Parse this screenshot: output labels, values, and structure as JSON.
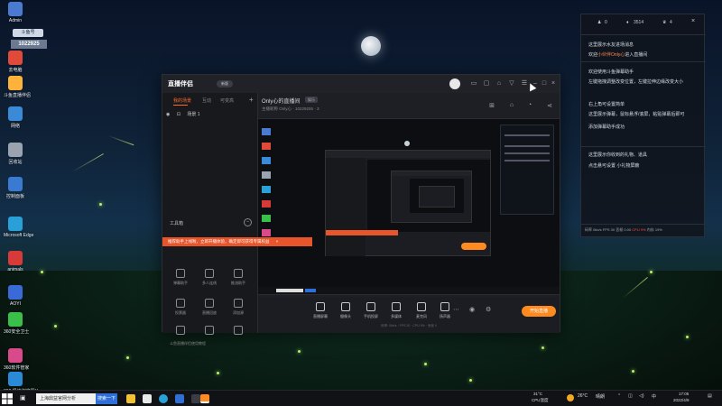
{
  "desktop": {
    "icons": [
      {
        "label": "Admin",
        "color": "#4a7bd0"
      },
      {
        "label": "去电脑",
        "color": "#e04a3a"
      },
      {
        "label": "斗鱼直播伴侣",
        "color": "#ffb23a"
      },
      {
        "label": "网络",
        "color": "#3a8ad8"
      },
      {
        "label": "回收站",
        "color": "#9aa4b0"
      },
      {
        "label": "控制面板",
        "color": "#3a7ad0"
      },
      {
        "label": "Microsoft Edge",
        "color": "#2aa0d8"
      },
      {
        "label": "animals",
        "color": "#d83a3a"
      },
      {
        "label": "AOYI",
        "color": "#3a6ad8"
      },
      {
        "label": "360安全卫士",
        "color": "#3ac04a"
      },
      {
        "label": "360软件管家",
        "color": "#d84a8a"
      },
      {
        "label": "360 极速浏览器X",
        "color": "#2a8ad8"
      }
    ],
    "overlay_badge": "1022925",
    "overlay_tag": "斗鱼号"
  },
  "app": {
    "logo": "直播伴侣",
    "version": "新版",
    "left_tabs": [
      "我的场景",
      "互动",
      "可变高"
    ],
    "scene_name": "场景 1",
    "tools_title": "工具箱",
    "tools": [
      {
        "label": "",
        "accent": true
      },
      {
        "label": ""
      },
      {
        "label": ""
      },
      {
        "label": "弹幕助手"
      },
      {
        "label": "多人连线"
      },
      {
        "label": "推流助手"
      },
      {
        "label": "投票器"
      },
      {
        "label": "直播回放"
      },
      {
        "label": "添加源"
      },
      {
        "label": ""
      },
      {
        "label": ""
      },
      {
        "label": ""
      }
    ],
    "notice": "推荐助手上线啦，立即开播体验，确定即可获得专属权益",
    "notice_close": "×",
    "help": "斗鱼直播伴侣使用教程",
    "room_title": "Only心的直播间",
    "room_badge": "娱乐",
    "room_meta": "主播昵称 Only心 · 10229255 · 3",
    "bottom_items": [
      "直播屏幕",
      "摄像头",
      "手机投屏",
      "多媒体",
      "麦克风",
      "扬声器"
    ],
    "go_live": "开始直播",
    "status_line": "码率: 0kb/s · FPS 30 · CPU 9% · 丢帧 0"
  },
  "chat": {
    "top_counts": [
      "0",
      "3514",
      "4"
    ],
    "messages": [
      {
        "text": "这里展示水友进场消息"
      },
      {
        "prefix": "欢迎",
        "highlight": "小伙伴Only心",
        "suffix": "进入直播间"
      },
      {
        "text": "欢迎使用斗鱼弹幕助手"
      },
      {
        "text": "左键拖拽调整改变位置，左键拉伸边缘改变大小"
      },
      {
        "text": "右上角可设置简单"
      },
      {
        "text": "这里展示弹幕，鼠标悬浮/滚屏，粘贴弹幕后即可"
      },
      {
        "text": "添加弹幕助手成功"
      },
      {
        "text": "这里展示你收到的礼物、道具"
      },
      {
        "text": "点击悬可设置 小礼物屏蔽"
      }
    ],
    "stats_prefix": "码率 0kb/s  FPS 30  丢帧 0.00",
    "stats_cpu": "CPU 9%",
    "stats_suffix": "内存 19%"
  },
  "taskbar": {
    "search_text": "上海鼎益官网分析",
    "search_button": "搜索一下",
    "weather_temp": "26°C",
    "weather_text": "晴朗",
    "cpu_value": "31°C",
    "cpu_label": "CPU温度",
    "time": "17:05",
    "date": "2022/4/9",
    "input_lang": "中"
  }
}
